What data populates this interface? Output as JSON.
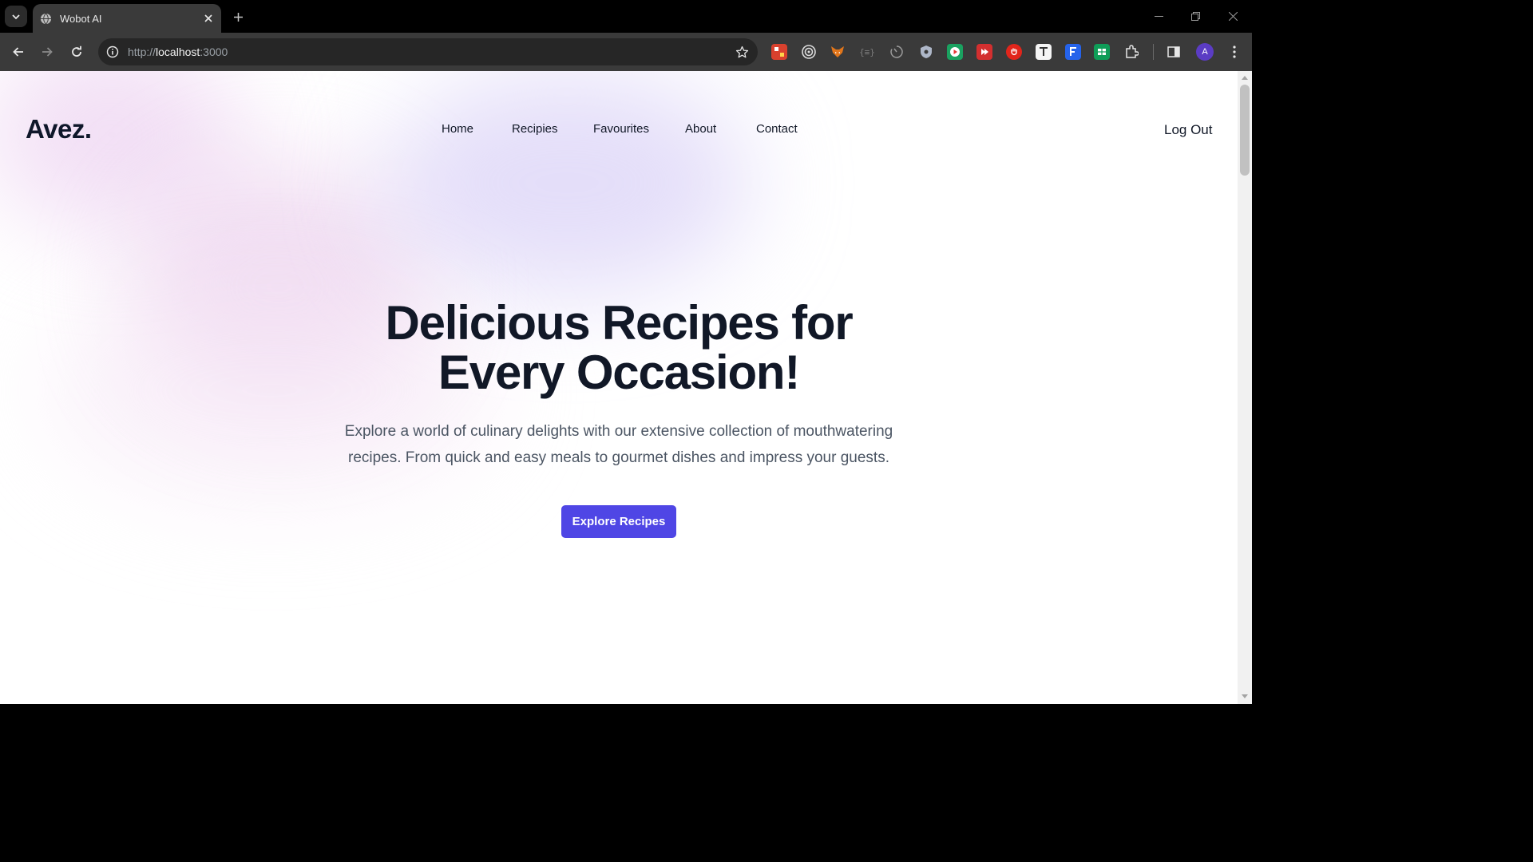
{
  "browser": {
    "tab_title": "Wobot AI",
    "url_scheme": "http://",
    "url_host": "localhost",
    "url_port": ":3000",
    "avatar_initial": "A"
  },
  "extensions": [
    "colorful-puzzle-icon",
    "target-icon",
    "fox-icon",
    "braces-icon",
    "timer-icon",
    "shield-icon",
    "green-play-icon",
    "red-play-icon",
    "red-hand-icon",
    "text-t-icon",
    "blue-f-icon",
    "green-sheet-icon",
    "puzzle-icon"
  ],
  "site": {
    "logo": "Avez.",
    "nav": [
      "Home",
      "Recipies",
      "Favourites",
      "About",
      "Contact"
    ],
    "logout": "Log Out"
  },
  "hero": {
    "title_line1": "Delicious Recipes for",
    "title_line2": "Every Occasion!",
    "description": "Explore a world of culinary delights with our extensive collection of mouthwatering recipes. From quick and easy meals to gourmet dishes and impress your guests.",
    "cta": "Explore Recipes"
  },
  "colors": {
    "accent": "#4f46e5",
    "heading": "#111827",
    "body_text": "#4b5563"
  }
}
